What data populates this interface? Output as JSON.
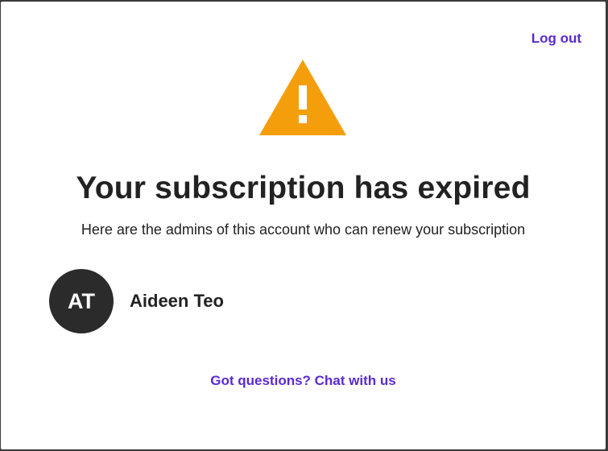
{
  "header": {
    "logout_label": "Log out"
  },
  "alert": {
    "icon": "warning-icon",
    "icon_color": "#f59e0b",
    "title": "Your subscription has expired",
    "subtitle": "Here are the admins of this account who can renew your subscription"
  },
  "admins": [
    {
      "initials": "AT",
      "name": "Aideen Teo"
    }
  ],
  "footer": {
    "chat_label": "Got questions? Chat with us"
  },
  "colors": {
    "link": "#5a2ad1",
    "text": "#222222",
    "avatar_bg": "#2b2b2b"
  }
}
